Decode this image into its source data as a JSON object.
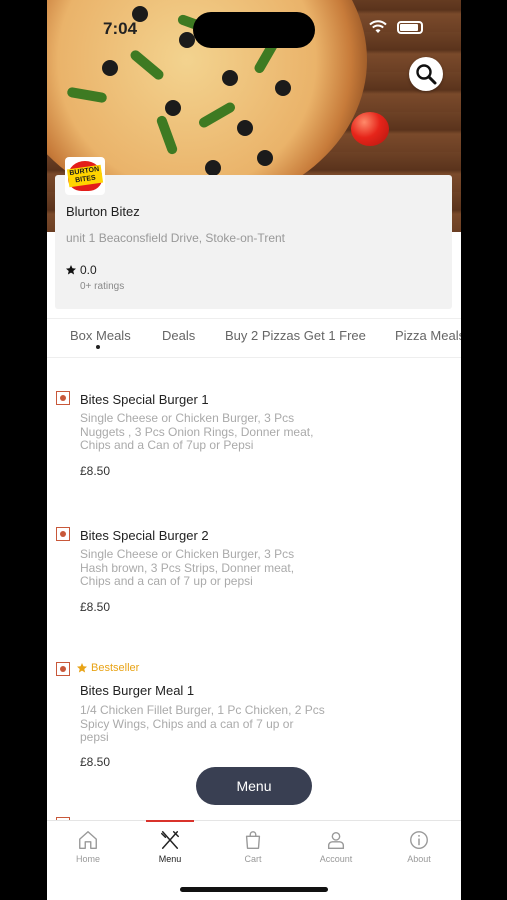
{
  "status_bar": {
    "time": "7:04"
  },
  "restaurant": {
    "logo_text": "BURTON BITES",
    "name": "Blurton Bitez",
    "address": "unit 1 Beaconsfield Drive, Stoke-on-Trent",
    "rating": "0.0",
    "ratings_count": "0+ ratings"
  },
  "tabs": [
    {
      "label": "Box Meals",
      "active": true
    },
    {
      "label": "Deals"
    },
    {
      "label": "Buy 2 Pizzas Get 1 Free"
    },
    {
      "label": "Pizza Meals"
    }
  ],
  "items": [
    {
      "title": "Bites Special Burger 1",
      "desc_lines": [
        "Single Cheese or Chicken Burger, 3 Pcs",
        "Nuggets , 3 Pcs Onion Rings, Donner meat,",
        "Chips and a Can of 7up or Pepsi"
      ],
      "price": "£8.50"
    },
    {
      "title": "Bites Special Burger 2",
      "desc_lines": [
        "Single Cheese or Chicken Burger, 3 Pcs",
        "Hash brown, 3 Pcs Strips, Donner meat,",
        "Chips and a can of 7 up or pepsi"
      ],
      "price": "£8.50"
    },
    {
      "badge": "Bestseller",
      "title": "Bites Burger Meal 1",
      "desc_lines": [
        "1/4 Chicken Fillet Burger, 1 Pc Chicken, 2 Pcs",
        "Spicy Wings, Chips and a can of 7 up or",
        "pepsi"
      ],
      "price": "£8.50"
    }
  ],
  "menu_button": "Menu",
  "tabbar": [
    {
      "label": "Home",
      "icon": "home-icon"
    },
    {
      "label": "Menu",
      "icon": "cutlery-icon",
      "active": true
    },
    {
      "label": "Cart",
      "icon": "bag-icon"
    },
    {
      "label": "Account",
      "icon": "user-icon"
    },
    {
      "label": "About",
      "icon": "info-icon"
    }
  ],
  "colors": {
    "accent": "#d9322b",
    "fab": "#393f52",
    "bestseller": "#e8a316",
    "veg_marker": "#c8583a"
  }
}
